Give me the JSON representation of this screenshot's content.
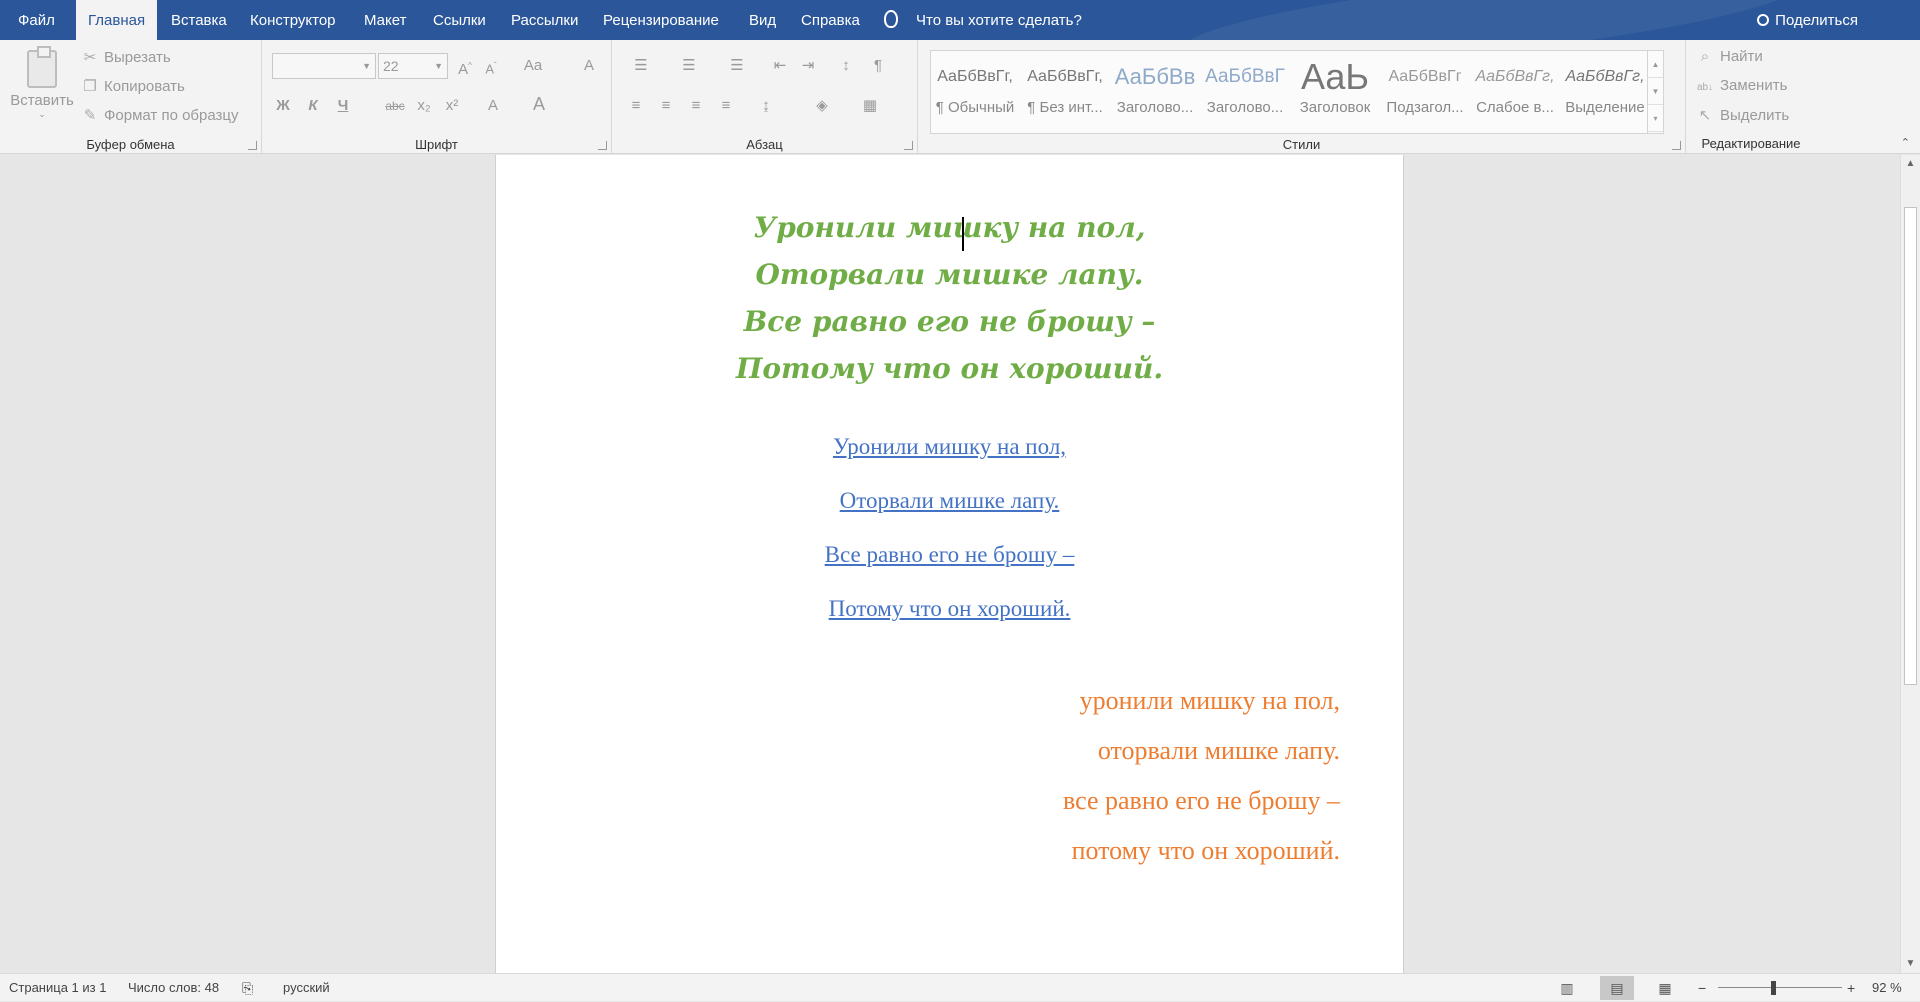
{
  "tabs": {
    "file": "Файл",
    "home": "Главная",
    "insert": "Вставка",
    "design": "Конструктор",
    "layout": "Макет",
    "references": "Ссылки",
    "mailings": "Рассылки",
    "review": "Рецензирование",
    "view": "Вид",
    "help": "Справка"
  },
  "tell_me": "Что вы хотите сделать?",
  "share": "Поделиться",
  "ribbon": {
    "clipboard": {
      "paste": "Вставить",
      "cut": "Вырезать",
      "copy": "Копировать",
      "format_painter": "Формат по образцу",
      "label": "Буфер обмена"
    },
    "font": {
      "font_name": "",
      "font_size": "22",
      "bold": "Ж",
      "italic": "К",
      "underline": "Ч",
      "strike": "abc",
      "subscript": "x₂",
      "superscript": "x²",
      "label": "Шрифт"
    },
    "paragraph": {
      "label": "Абзац"
    },
    "styles": {
      "label": "Стили",
      "items": [
        {
          "preview": "АаБбВвГг,",
          "name": "¶ Обычный"
        },
        {
          "preview": "АаБбВвГг,",
          "name": "¶ Без инт..."
        },
        {
          "preview": "АаБбВв",
          "name": "Заголово..."
        },
        {
          "preview": "АаБбВвГ",
          "name": "Заголово..."
        },
        {
          "preview": "АаЬ",
          "name": "Заголовок"
        },
        {
          "preview": "АаБбВвГг",
          "name": "Подзагол..."
        },
        {
          "preview": "АаБбВвГг,",
          "name": "Слабое в..."
        },
        {
          "preview": "АаБбВвГг,",
          "name": "Выделение"
        }
      ]
    },
    "editing": {
      "find": "Найти",
      "replace": "Заменить",
      "select": "Выделить",
      "label": "Редактирование"
    }
  },
  "document": {
    "green_lines": [
      "Уронили мишку на пол,",
      "Оторвали мишке лапу.",
      "Все равно его не брошу –",
      "Потому что он хороший."
    ],
    "blue_lines": [
      "Уронили мишку на пол,",
      "Оторвали мишке лапу.",
      "Все равно его не брошу –",
      "Потому что он хороший."
    ],
    "orange_lines": [
      "уронили мишку на пол,",
      "оторвали мишке лапу.",
      "все равно его не брошу –",
      "потому что он хороший."
    ],
    "colors": {
      "green": "#70ad47",
      "blue": "#4472c4",
      "orange": "#ed7d31"
    }
  },
  "status": {
    "page": "Страница 1 из 1",
    "words": "Число слов: 48",
    "language": "русский",
    "zoom_out": "−",
    "zoom_in": "+",
    "zoom": "92 %"
  }
}
